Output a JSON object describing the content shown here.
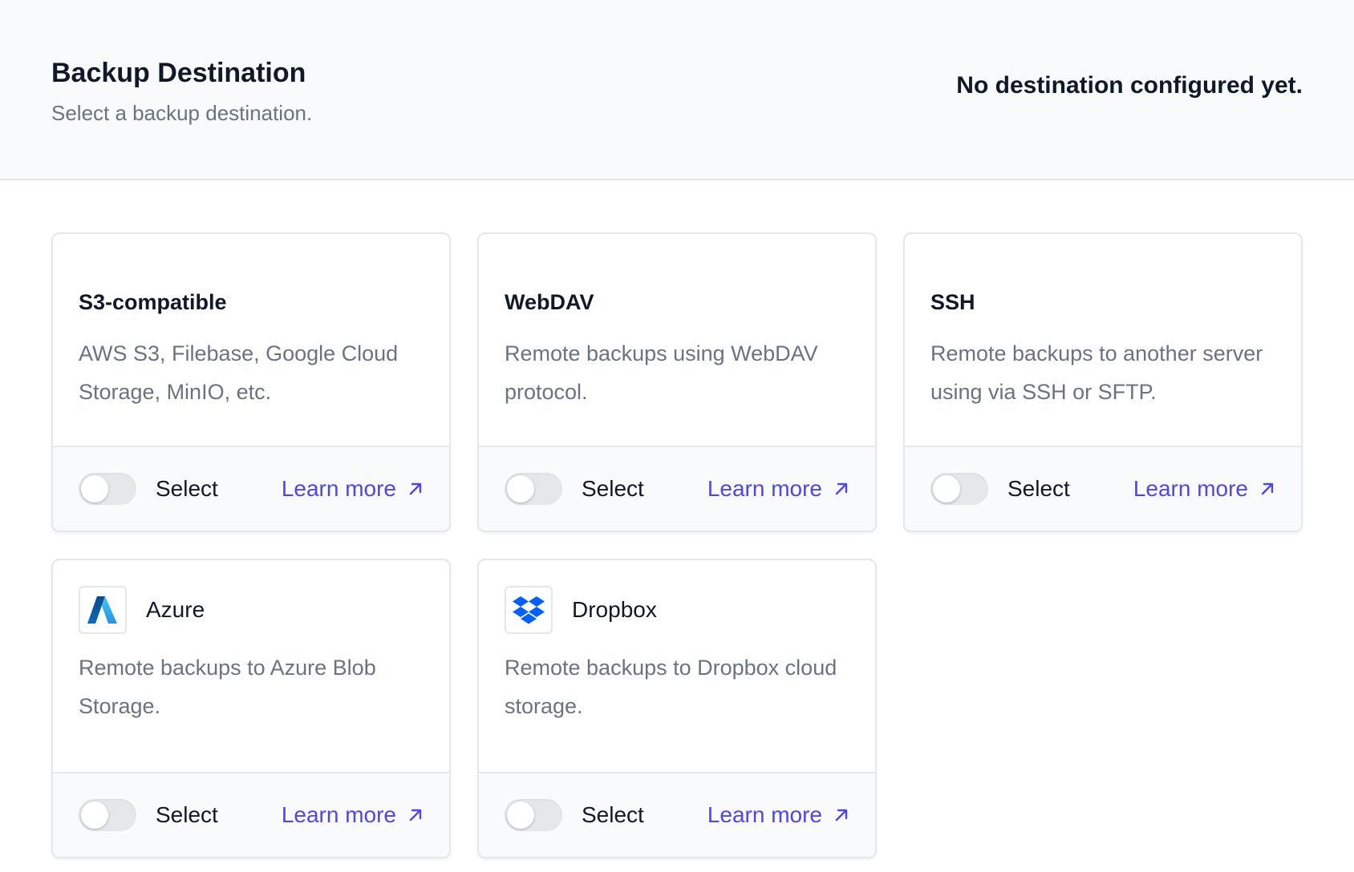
{
  "header": {
    "title": "Backup Destination",
    "subtitle": "Select a backup destination.",
    "status": "No destination configured yet."
  },
  "cards": [
    {
      "title": "S3-compatible",
      "description": "AWS S3, Filebase, Google Cloud Storage, MinIO, etc.",
      "select_label": "Select",
      "learn_more_label": "Learn more"
    },
    {
      "title": "WebDAV",
      "description": "Remote backups using WebDAV protocol.",
      "select_label": "Select",
      "learn_more_label": "Learn more"
    },
    {
      "title": "SSH",
      "description": "Remote backups to another server using via SSH or SFTP.",
      "select_label": "Select",
      "learn_more_label": "Learn more"
    },
    {
      "title": "Azure",
      "logo": "azure-logo-icon",
      "description": "Remote backups to Azure Blob Storage.",
      "select_label": "Select",
      "learn_more_label": "Learn more"
    },
    {
      "title": "Dropbox",
      "logo": "dropbox-logo-icon",
      "description": "Remote backups to Dropbox cloud storage.",
      "select_label": "Select",
      "learn_more_label": "Learn more"
    }
  ],
  "colors": {
    "accent": "#4f46e5",
    "header_bg": "#f9fafb",
    "border": "#e5e7eb",
    "muted_text": "#6b7280"
  },
  "icons": {
    "learn_more": "arrow-up-right-icon"
  }
}
